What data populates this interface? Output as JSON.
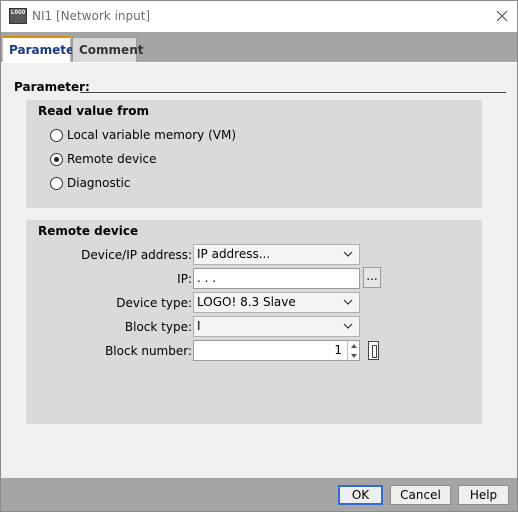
{
  "window": {
    "title": "NI1 [Network input]",
    "icon_text": "LOGO"
  },
  "tabs": [
    {
      "label": "Parameter",
      "active": true
    },
    {
      "label": "Comment",
      "active": false
    }
  ],
  "section": {
    "title": "Parameter:"
  },
  "read_value": {
    "title": "Read value from",
    "options": [
      {
        "label": "Local variable memory (VM)",
        "checked": false
      },
      {
        "label": "Remote device",
        "checked": true
      },
      {
        "label": "Diagnostic",
        "checked": false
      }
    ]
  },
  "remote_device": {
    "title": "Remote device",
    "device_ip_label": "Device/IP address:",
    "device_ip_value": "IP address...",
    "ip_label": "IP:",
    "ip_value": " .   .   .",
    "ellipsis": "...",
    "device_type_label": "Device type:",
    "device_type_value": "LOGO! 8.3 Slave",
    "block_type_label": "Block type:",
    "block_type_value": "I",
    "block_number_label": "Block number:",
    "block_number_value": "1"
  },
  "buttons": {
    "ok": "OK",
    "cancel": "Cancel",
    "help": "Help"
  },
  "colors": {
    "active_tab_accent": "#e08a16",
    "active_tab_text": "#1a3a8a",
    "default_button_border": "#2e6bd6"
  }
}
